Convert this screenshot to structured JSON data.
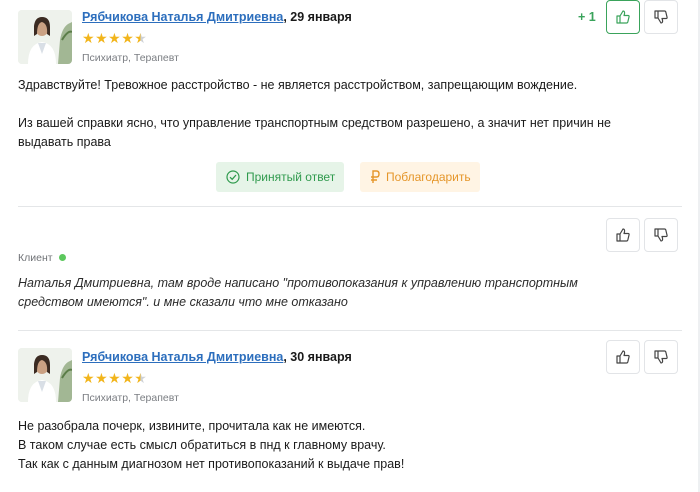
{
  "answers": [
    {
      "author": "Рябчикова Наталья Дмитриевна",
      "date": ", 29 января",
      "rating": 4.5,
      "specialty": "Психиатр, Терапевт",
      "paragraphs": [
        "Здравствуйте! Тревожное расстройство - не является расстройством, запрещающим вождение.",
        "Из вашей справки ясно, что управление транспортным средством разрешено, а значит нет причин не",
        "выдавать права"
      ],
      "vote_count": "+ 1",
      "accepted_label": "Принятый ответ",
      "thanks_label": "Поблагодарить"
    },
    {
      "author": "Рябчикова Наталья Дмитриевна",
      "date": ", 30 января",
      "rating": 4.5,
      "specialty": "Психиатр, Терапевт",
      "paragraphs": [
        "Не разобрала почерк, извините, прочитала как не имеются.",
        "В таком случае есть смысл обратиться в пнд к главному врачу.",
        "Так как с данным диагнозом нет противопоказаний к выдаче прав!"
      ]
    }
  ],
  "client_reply": {
    "label": "Клиент",
    "lines": [
      "Наталья Дмитриевна, там вроде написано \"противопоказания к управлению транспортным",
      "средством имеются\". и мне сказали что мне отказано"
    ]
  },
  "colors": {
    "link": "#2c6ebd",
    "star": "#f2b51c",
    "accepted": "#2f9a4d",
    "thanks": "#e5962a",
    "online": "#5cc85d"
  },
  "icons": [
    "thumbs-up-icon",
    "thumbs-down-icon",
    "check-circle-icon",
    "ruble-icon",
    "star-icon",
    "online-indicator"
  ]
}
